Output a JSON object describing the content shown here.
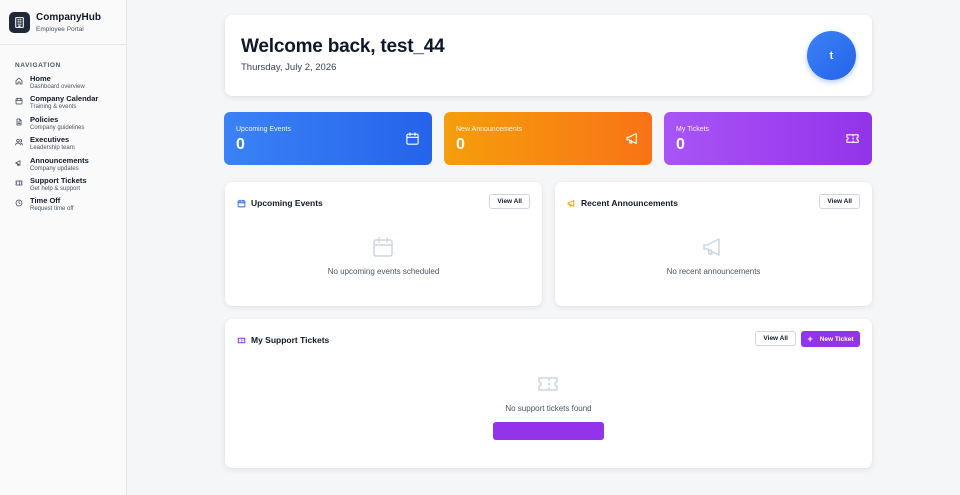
{
  "brand": {
    "name": "CompanyHub",
    "subtitle": "Employee Portal",
    "logo_icon": "building-icon"
  },
  "sidebar": {
    "heading": "NAVIGATION",
    "items": [
      {
        "label": "Home",
        "desc": "Dashboard overview",
        "icon": "home-icon"
      },
      {
        "label": "Company Calendar",
        "desc": "Training & events",
        "icon": "calendar-icon"
      },
      {
        "label": "Policies",
        "desc": "Company guidelines",
        "icon": "document-icon"
      },
      {
        "label": "Executives",
        "desc": "Leadership team",
        "icon": "users-icon"
      },
      {
        "label": "Announcements",
        "desc": "Company updates",
        "icon": "megaphone-icon"
      },
      {
        "label": "Support Tickets",
        "desc": "Get help & support",
        "icon": "ticket-icon"
      },
      {
        "label": "Time Off",
        "desc": "Request time off",
        "icon": "clock-icon"
      }
    ]
  },
  "welcome": {
    "title": "Welcome back, test_44",
    "date": "Thursday, July 2, 2026",
    "avatar_initial": "t"
  },
  "stats": [
    {
      "label": "Upcoming Events",
      "value": "0",
      "icon": "calendar-icon",
      "color": "#2563eb"
    },
    {
      "label": "New Announcements",
      "value": "0",
      "icon": "megaphone-icon",
      "color": "#f97316"
    },
    {
      "label": "My Tickets",
      "value": "0",
      "icon": "ticket-icon",
      "color": "#9333ea"
    }
  ],
  "events_panel": {
    "title": "Upcoming Events",
    "view_all": "View All",
    "empty": "No upcoming events scheduled"
  },
  "announcements_panel": {
    "title": "Recent Announcements",
    "view_all": "View All",
    "empty": "No recent announcements"
  },
  "tickets_panel": {
    "title": "My Support Tickets",
    "view_all": "View All",
    "new_ticket": "New Ticket",
    "empty": "No support tickets found",
    "create_button": ""
  },
  "colors": {
    "accent_blue": "#2563eb",
    "accent_orange": "#f97316",
    "accent_purple": "#9333ea"
  }
}
